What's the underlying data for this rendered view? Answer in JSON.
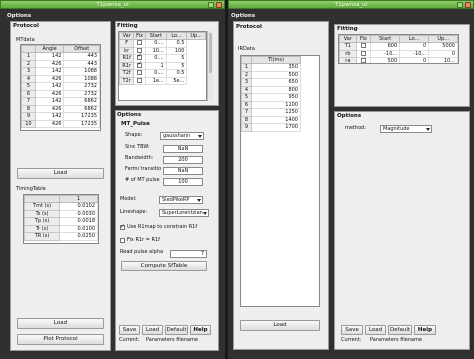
{
  "left_window": {
    "title": "T1pwnsa_ui",
    "options_label": "Options",
    "protocol": {
      "label": "Protocol",
      "mtdata_label": "MTdata",
      "columns": [
        "",
        "Angle",
        "Offset"
      ],
      "rows": [
        [
          "1",
          "142",
          "443"
        ],
        [
          "2",
          "426",
          "443"
        ],
        [
          "3",
          "142",
          "1088"
        ],
        [
          "4",
          "426",
          "1088"
        ],
        [
          "5",
          "142",
          "2732"
        ],
        [
          "6",
          "426",
          "2732"
        ],
        [
          "7",
          "142",
          "6862"
        ],
        [
          "8",
          "426",
          "6862"
        ],
        [
          "9",
          "142",
          "17235"
        ],
        [
          "10",
          "426",
          "17235"
        ]
      ],
      "load1": "Load",
      "timing_label": "TimingTable",
      "timing_header": "1",
      "timing_rows": [
        [
          "Tmt (s)",
          "0.0102"
        ],
        [
          "Ts (s)",
          "0.0030"
        ],
        [
          "Tp (s)",
          "0.0018"
        ],
        [
          "Tr (s)",
          "0.0100"
        ],
        [
          "TR (s)",
          "0.0250"
        ]
      ],
      "load2": "Load",
      "plot": "Plot Protocol"
    },
    "fitting": {
      "label": "Fitting",
      "columns": [
        "Var",
        "Fix",
        "Start",
        "Lo...",
        "Up..."
      ],
      "rows": [
        [
          "F",
          false,
          "0....",
          "0.5"
        ],
        [
          "kr",
          false,
          "10...",
          "100"
        ],
        [
          "R1f",
          true,
          "0....",
          "5"
        ],
        [
          "R1r",
          true,
          "1",
          "5"
        ],
        [
          "T2f",
          false,
          "0....",
          "0.5"
        ],
        [
          "T2r",
          false,
          "1e...",
          "5e..."
        ]
      ]
    },
    "options": {
      "label": "Options",
      "mt_pulse_label": "MT_Pulse",
      "shape_label": "Shape:",
      "shape_value": "gausshann",
      "sinc_label": "Sinc TBW:",
      "sinc_value": "NaN",
      "bandwidth_label": "Bandwidth:",
      "bandwidth_value": "200",
      "fermi_label": "Fermi transitio",
      "fermi_value": "NaN",
      "nmt_label": "# of MT pulse",
      "nmt_value": "100",
      "model_label": "Model:",
      "model_value": "SledPikeRP",
      "lineshape_label": "Lineshape:",
      "lineshape_value": "SuperLorentzian",
      "use_r1map": "Use R1map to constrain R1f",
      "fix_r1r": "Fix R1r = R1f",
      "readpulse_label": "Read pulse alpha",
      "readpulse_value": "7",
      "compute": "Compute SfTable"
    },
    "buttons": {
      "save": "Save",
      "load": "Load",
      "default": "Default",
      "help": "Help"
    },
    "current_label": "Current:",
    "current_value": "Parameters filename"
  },
  "right_window": {
    "title": "T1pwnsa_ui",
    "options_label": "Options",
    "protocol": {
      "label": "Protocol",
      "irdata_label": "IRData",
      "columns": [
        "",
        "TI(ms)"
      ],
      "rows": [
        [
          "1",
          "350"
        ],
        [
          "2",
          "500"
        ],
        [
          "3",
          "650"
        ],
        [
          "4",
          "800"
        ],
        [
          "5",
          "950"
        ],
        [
          "6",
          "1100"
        ],
        [
          "7",
          "1250"
        ],
        [
          "8",
          "1400"
        ],
        [
          "9",
          "1700"
        ]
      ],
      "load": "Load"
    },
    "fitting": {
      "label": "Fitting",
      "columns": [
        "Var",
        "Fix",
        "Start",
        "Lo...",
        "Up..."
      ],
      "rows": [
        [
          "T1",
          false,
          "600",
          "0",
          "5000"
        ],
        [
          "rb",
          false,
          "-10...",
          "-10...",
          "0"
        ],
        [
          "ra",
          false,
          "500",
          "0",
          "10..."
        ]
      ]
    },
    "options": {
      "label": "Options",
      "method_label": "method:",
      "method_value": "Magnitude"
    },
    "buttons": {
      "save": "Save",
      "load": "Load",
      "default": "Default",
      "help": "Help"
    },
    "current_label": "Current:",
    "current_value": "Parameters filename"
  },
  "colors": {
    "titlebar": "#6cb847",
    "dark_bg": "#303030",
    "panel": "#eeeeee"
  }
}
